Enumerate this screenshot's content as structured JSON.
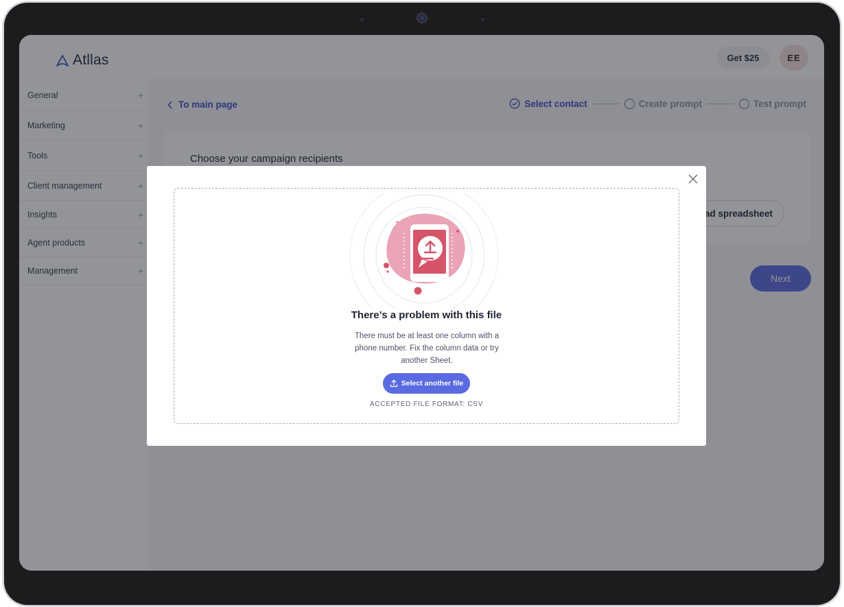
{
  "app": {
    "brand": "Atllas"
  },
  "sidebar": {
    "items": [
      {
        "label": "General"
      },
      {
        "label": "Marketing"
      },
      {
        "label": "Tools"
      },
      {
        "label": "Client management"
      },
      {
        "label": "Insights"
      },
      {
        "label": "Agent products"
      },
      {
        "label": "Management"
      }
    ],
    "expand_glyph": "+"
  },
  "header": {
    "promo_label": "Get $25",
    "avatar_initials": "EE"
  },
  "page": {
    "back_link": "To main page",
    "steps": [
      {
        "label": "Select contact",
        "state": "active"
      },
      {
        "label": "Create prompt",
        "state": "pending"
      },
      {
        "label": "Test prompt",
        "state": "pending"
      }
    ],
    "card_title": "Choose your campaign recipients",
    "upload_label": "pad spreadsheet",
    "next_label": "Next"
  },
  "modal": {
    "title": "There’s a problem with this file",
    "message": "There must be at least one column with a phone number. Fix the column data or try another Sheet.",
    "select_button": "Select another file",
    "format_note": "ACCEPTED FILE FORMAT: CSV"
  },
  "colors": {
    "accent": "#5a6ae0",
    "link": "#3d4ec9",
    "illustration_pink": "#eba3b6",
    "illustration_red": "#d6546a"
  },
  "icons": [
    "atllas-logo-icon",
    "plus-icon",
    "chevron-left-icon",
    "check-circle-icon",
    "circle-icon",
    "close-icon",
    "upload-icon"
  ]
}
